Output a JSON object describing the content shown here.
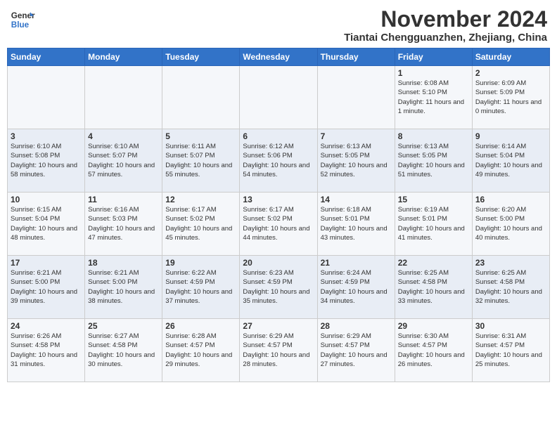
{
  "header": {
    "logo": {
      "line1": "General",
      "line2": "Blue"
    },
    "month": "November 2024",
    "location": "Tiantai Chengguanzhen, Zhejiang, China"
  },
  "weekdays": [
    "Sunday",
    "Monday",
    "Tuesday",
    "Wednesday",
    "Thursday",
    "Friday",
    "Saturday"
  ],
  "weeks": [
    [
      {
        "day": "",
        "detail": ""
      },
      {
        "day": "",
        "detail": ""
      },
      {
        "day": "",
        "detail": ""
      },
      {
        "day": "",
        "detail": ""
      },
      {
        "day": "",
        "detail": ""
      },
      {
        "day": "1",
        "detail": "Sunrise: 6:08 AM\nSunset: 5:10 PM\nDaylight: 11 hours and 1 minute."
      },
      {
        "day": "2",
        "detail": "Sunrise: 6:09 AM\nSunset: 5:09 PM\nDaylight: 11 hours and 0 minutes."
      }
    ],
    [
      {
        "day": "3",
        "detail": "Sunrise: 6:10 AM\nSunset: 5:08 PM\nDaylight: 10 hours and 58 minutes."
      },
      {
        "day": "4",
        "detail": "Sunrise: 6:10 AM\nSunset: 5:07 PM\nDaylight: 10 hours and 57 minutes."
      },
      {
        "day": "5",
        "detail": "Sunrise: 6:11 AM\nSunset: 5:07 PM\nDaylight: 10 hours and 55 minutes."
      },
      {
        "day": "6",
        "detail": "Sunrise: 6:12 AM\nSunset: 5:06 PM\nDaylight: 10 hours and 54 minutes."
      },
      {
        "day": "7",
        "detail": "Sunrise: 6:13 AM\nSunset: 5:05 PM\nDaylight: 10 hours and 52 minutes."
      },
      {
        "day": "8",
        "detail": "Sunrise: 6:13 AM\nSunset: 5:05 PM\nDaylight: 10 hours and 51 minutes."
      },
      {
        "day": "9",
        "detail": "Sunrise: 6:14 AM\nSunset: 5:04 PM\nDaylight: 10 hours and 49 minutes."
      }
    ],
    [
      {
        "day": "10",
        "detail": "Sunrise: 6:15 AM\nSunset: 5:04 PM\nDaylight: 10 hours and 48 minutes."
      },
      {
        "day": "11",
        "detail": "Sunrise: 6:16 AM\nSunset: 5:03 PM\nDaylight: 10 hours and 47 minutes."
      },
      {
        "day": "12",
        "detail": "Sunrise: 6:17 AM\nSunset: 5:02 PM\nDaylight: 10 hours and 45 minutes."
      },
      {
        "day": "13",
        "detail": "Sunrise: 6:17 AM\nSunset: 5:02 PM\nDaylight: 10 hours and 44 minutes."
      },
      {
        "day": "14",
        "detail": "Sunrise: 6:18 AM\nSunset: 5:01 PM\nDaylight: 10 hours and 43 minutes."
      },
      {
        "day": "15",
        "detail": "Sunrise: 6:19 AM\nSunset: 5:01 PM\nDaylight: 10 hours and 41 minutes."
      },
      {
        "day": "16",
        "detail": "Sunrise: 6:20 AM\nSunset: 5:00 PM\nDaylight: 10 hours and 40 minutes."
      }
    ],
    [
      {
        "day": "17",
        "detail": "Sunrise: 6:21 AM\nSunset: 5:00 PM\nDaylight: 10 hours and 39 minutes."
      },
      {
        "day": "18",
        "detail": "Sunrise: 6:21 AM\nSunset: 5:00 PM\nDaylight: 10 hours and 38 minutes."
      },
      {
        "day": "19",
        "detail": "Sunrise: 6:22 AM\nSunset: 4:59 PM\nDaylight: 10 hours and 37 minutes."
      },
      {
        "day": "20",
        "detail": "Sunrise: 6:23 AM\nSunset: 4:59 PM\nDaylight: 10 hours and 35 minutes."
      },
      {
        "day": "21",
        "detail": "Sunrise: 6:24 AM\nSunset: 4:59 PM\nDaylight: 10 hours and 34 minutes."
      },
      {
        "day": "22",
        "detail": "Sunrise: 6:25 AM\nSunset: 4:58 PM\nDaylight: 10 hours and 33 minutes."
      },
      {
        "day": "23",
        "detail": "Sunrise: 6:25 AM\nSunset: 4:58 PM\nDaylight: 10 hours and 32 minutes."
      }
    ],
    [
      {
        "day": "24",
        "detail": "Sunrise: 6:26 AM\nSunset: 4:58 PM\nDaylight: 10 hours and 31 minutes."
      },
      {
        "day": "25",
        "detail": "Sunrise: 6:27 AM\nSunset: 4:58 PM\nDaylight: 10 hours and 30 minutes."
      },
      {
        "day": "26",
        "detail": "Sunrise: 6:28 AM\nSunset: 4:57 PM\nDaylight: 10 hours and 29 minutes."
      },
      {
        "day": "27",
        "detail": "Sunrise: 6:29 AM\nSunset: 4:57 PM\nDaylight: 10 hours and 28 minutes."
      },
      {
        "day": "28",
        "detail": "Sunrise: 6:29 AM\nSunset: 4:57 PM\nDaylight: 10 hours and 27 minutes."
      },
      {
        "day": "29",
        "detail": "Sunrise: 6:30 AM\nSunset: 4:57 PM\nDaylight: 10 hours and 26 minutes."
      },
      {
        "day": "30",
        "detail": "Sunrise: 6:31 AM\nSunset: 4:57 PM\nDaylight: 10 hours and 25 minutes."
      }
    ]
  ]
}
